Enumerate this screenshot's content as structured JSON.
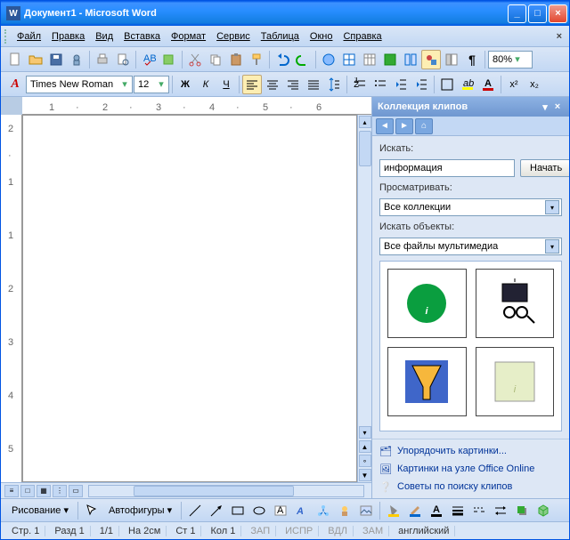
{
  "title": "Документ1 - Microsoft Word",
  "menu": {
    "file": "Файл",
    "edit": "Правка",
    "view": "Вид",
    "insert": "Вставка",
    "format": "Формат",
    "tools": "Сервис",
    "table": "Таблица",
    "window": "Окно",
    "help": "Справка"
  },
  "format_toolbar": {
    "style_glyph": "A",
    "font": "Times New Roman",
    "size": "12",
    "bold": "Ж",
    "italic": "К",
    "underline": "Ч"
  },
  "zoom": "80%",
  "taskpane": {
    "title": "Коллекция клипов",
    "search_label": "Искать:",
    "search_value": "информация",
    "search_button": "Начать",
    "browse_label": "Просматривать:",
    "browse_value": "Все коллекции",
    "objects_label": "Искать объекты:",
    "objects_value": "Все файлы мультимедиа",
    "link_organize": "Упорядочить картинки...",
    "link_online": "Картинки на узле Office Online",
    "link_tips": "Советы по поиску клипов"
  },
  "drawbar": {
    "drawing": "Рисование",
    "autoshapes": "Автофигуры"
  },
  "status": {
    "page": "Стр. 1",
    "section": "Разд 1",
    "pages": "1/1",
    "at": "На 2см",
    "line": "Ст 1",
    "col": "Кол 1",
    "rec": "ЗАП",
    "trk": "ИСПР",
    "ext": "ВДЛ",
    "ovr": "ЗАМ",
    "lang": "английский"
  }
}
